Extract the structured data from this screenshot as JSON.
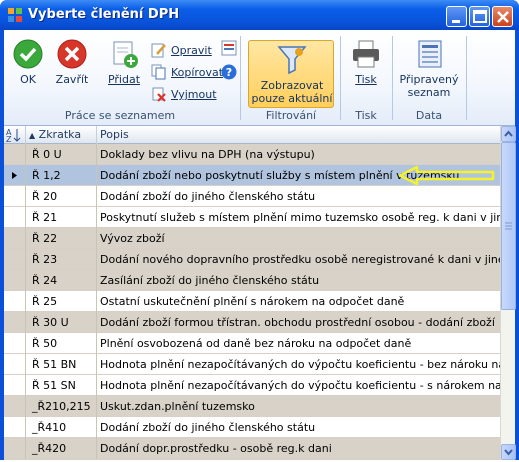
{
  "window": {
    "title": "Vyberte členění DPH"
  },
  "ribbon": {
    "groups": [
      {
        "label": "Práce se seznamem"
      },
      {
        "label": "Filtrování"
      },
      {
        "label": "Tisk"
      },
      {
        "label": "Data"
      }
    ],
    "ok": "OK",
    "close": "Zavřít",
    "add": "Přidat",
    "edit": "Opravit",
    "copy": "Kopírovat",
    "delete": "Vyjmout",
    "filter_line1": "Zobrazovat",
    "filter_line2": "pouze aktuální",
    "print": "Tisk",
    "prepared_line1": "Připravený",
    "prepared_line2": "seznam"
  },
  "grid": {
    "headers": {
      "code": "Zkratka",
      "description": "Popis"
    },
    "rows": [
      {
        "code": "Ř 0 U",
        "description": "Doklady bez vlivu na DPH (na výstupu)"
      },
      {
        "code": "Ř 1,2",
        "description": "Dodání zboží nebo poskytnutí služby s místem plnění v tuzemsku"
      },
      {
        "code": "Ř 20",
        "description": "Dodání zboží do jiného členského státu"
      },
      {
        "code": "Ř 21",
        "description": "Poskytnutí služeb s místem plnění mimo tuzemsko osobě reg. k dani v jiném čl. státě"
      },
      {
        "code": "Ř 22",
        "description": "Vývoz zboží"
      },
      {
        "code": "Ř 23",
        "description": "Dodání nového dopravního prostředku osobě neregistrované k dani v jiném členském"
      },
      {
        "code": "Ř 24",
        "description": "Zasílání zboží do jiného členského státu"
      },
      {
        "code": "Ř 25",
        "description": "Ostatní uskutečnění plnění s nárokem na odpočet daně"
      },
      {
        "code": "Ř 30 U",
        "description": "Dodání zboží formou třístran. obchodu prostřední osobou - dodání zboží"
      },
      {
        "code": "Ř 50",
        "description": "Plnění osvobozená od daně bez nároku na odpočet daně"
      },
      {
        "code": "Ř 51 BN",
        "description": "Hodnota plnění nezapočítávaných do výpočtu koeficientu - bez nároku na odpočet"
      },
      {
        "code": "Ř 51 SN",
        "description": "Hodnota plnění nezapočítávaných do výpočtu koeficientu - s nárokem na odpočet"
      },
      {
        "code": "_Ř210,215",
        "description": "Uskut.zdan.plnění tuzemsko"
      },
      {
        "code": "_Ř410",
        "description": "Dodání zboží do jiného členského státu"
      },
      {
        "code": "_Ř420",
        "description": "Dodání dopr.prostředku - osobě reg.k dani"
      }
    ]
  },
  "colors": {
    "titlebar": "#0a54dc",
    "selected_row": "#b0c4df",
    "alt_row": "#d8d2c8",
    "highlight_arrow": "#f5f22a",
    "filter_active": "#ffcf5c"
  },
  "icons": [
    "app-icon",
    "ok-icon",
    "close-icon",
    "add-icon",
    "edit-icon",
    "copy-icon",
    "delete-icon",
    "filter-funnel-icon",
    "printer-icon",
    "prepared-list-icon",
    "help-icon",
    "sort-icon",
    "row-pointer-icon",
    "annotation-arrow-icon"
  ]
}
